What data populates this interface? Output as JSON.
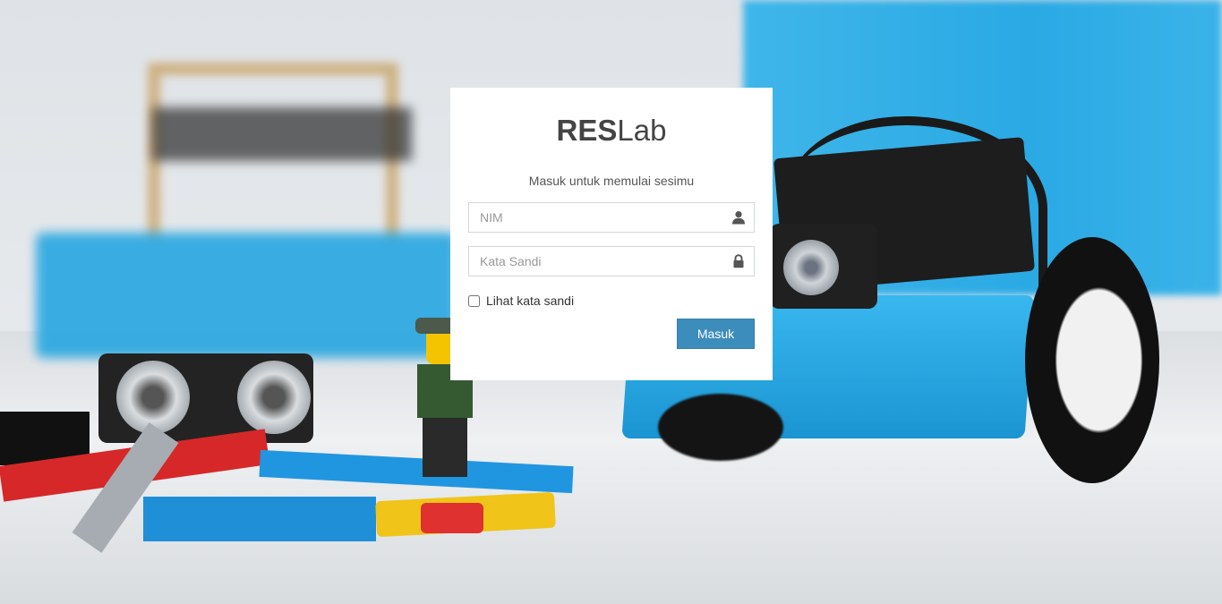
{
  "brand": {
    "bold": "RES",
    "light": "Lab"
  },
  "login_message": "Masuk untuk memulai sesimu",
  "username": {
    "placeholder": "NIM",
    "value": "",
    "icon": "user-icon"
  },
  "password": {
    "placeholder": "Kata Sandi",
    "value": "",
    "icon": "lock-icon"
  },
  "show_password": {
    "label": "Lihat kata sandi",
    "checked": false
  },
  "submit": {
    "label": "Masuk"
  },
  "colors": {
    "primary": "#3c8dbc",
    "box_bg": "#ffffff",
    "input_border": "#d2d6de"
  }
}
